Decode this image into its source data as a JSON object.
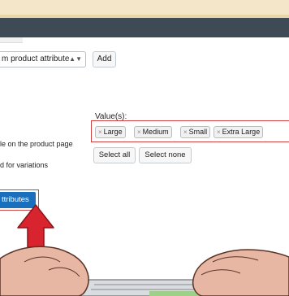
{
  "attribute_select": {
    "value": "m product attribute",
    "arrows": "▲▼"
  },
  "add_label": "Add",
  "values": {
    "label": "Value(s):",
    "tags": [
      "Large",
      "Medium",
      "Small",
      "Extra Large"
    ],
    "remove_glyph": "×"
  },
  "select_all": "Select all",
  "select_none": "Select none",
  "visible_text": "le on the product page",
  "variations_text": "d for variations",
  "save_label": "ttributes",
  "colors": {
    "accent": "#1a6fbd",
    "highlight": "#d04040",
    "arrow": "#d8242f"
  }
}
